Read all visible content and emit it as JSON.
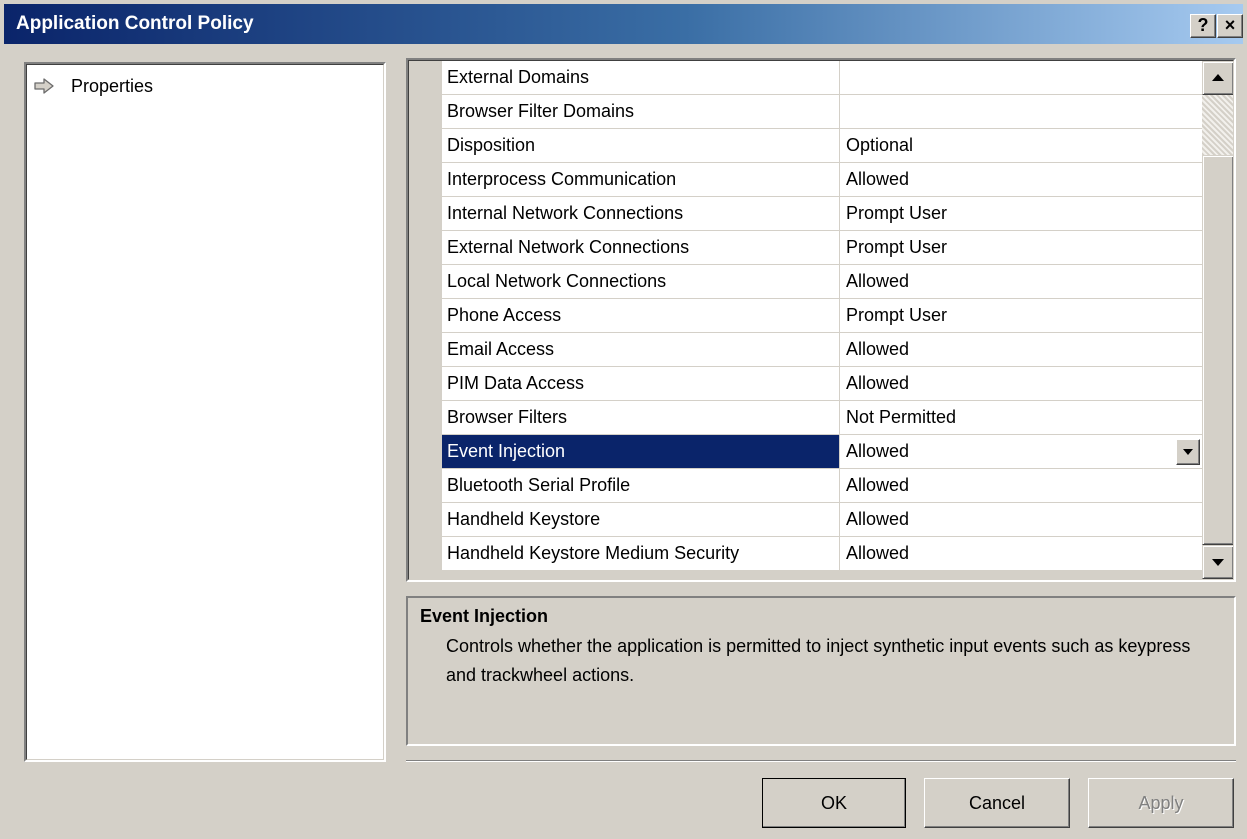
{
  "window": {
    "title": "Application Control Policy",
    "help_button": "?",
    "close_button": "×"
  },
  "tree": {
    "items": [
      {
        "label": "Properties",
        "icon": "arrow-right-icon"
      }
    ]
  },
  "grid": {
    "rows": [
      {
        "name": "External Domains",
        "value": ""
      },
      {
        "name": "Browser Filter Domains",
        "value": ""
      },
      {
        "name": "Disposition",
        "value": "Optional"
      },
      {
        "name": "Interprocess Communication",
        "value": "Allowed"
      },
      {
        "name": "Internal Network Connections",
        "value": "Prompt User"
      },
      {
        "name": "External Network Connections",
        "value": "Prompt User"
      },
      {
        "name": "Local Network Connections",
        "value": "Allowed"
      },
      {
        "name": "Phone Access",
        "value": "Prompt User"
      },
      {
        "name": "Email Access",
        "value": "Allowed"
      },
      {
        "name": "PIM Data Access",
        "value": "Allowed"
      },
      {
        "name": "Browser Filters",
        "value": "Not Permitted"
      },
      {
        "name": "Event Injection",
        "value": "Allowed",
        "selected": true
      },
      {
        "name": "Bluetooth Serial Profile",
        "value": "Allowed"
      },
      {
        "name": "Handheld Keystore",
        "value": "Allowed"
      },
      {
        "name": "Handheld Keystore Medium Security",
        "value": "Allowed"
      }
    ]
  },
  "description": {
    "title": "Event Injection",
    "text": "Controls whether the application is permitted to inject synthetic input events such as keypress and trackwheel actions."
  },
  "buttons": {
    "ok": "OK",
    "cancel": "Cancel",
    "apply": "Apply"
  },
  "colors": {
    "selection": "#0a246a",
    "face": "#d4d0c8"
  }
}
